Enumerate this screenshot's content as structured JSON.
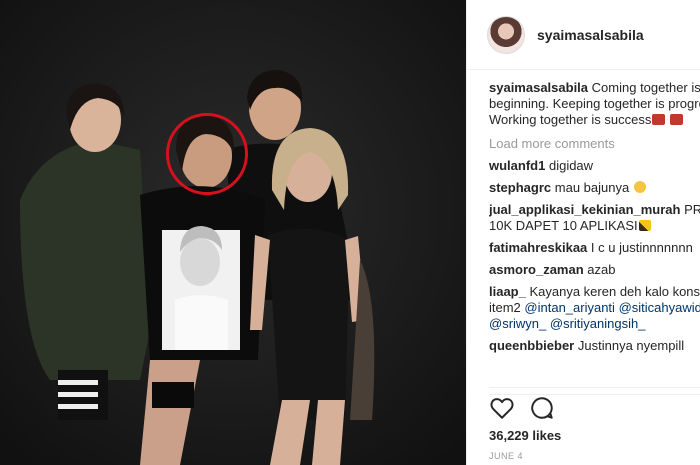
{
  "post": {
    "username": "syaimasalsabila"
  },
  "caption": {
    "user": "syaimasalsabila",
    "line1": "Coming together is a",
    "line2": "beginning. Keeping together is progress.",
    "line3": "Working together is success"
  },
  "load_more": "Load more comments",
  "comments": [
    {
      "user": "wulanfd1",
      "text": "digidaw"
    },
    {
      "user": "stephagrc",
      "text": "mau bajunya"
    },
    {
      "user": "jual_applikasi_kekinian_murah",
      "text": "PROMO",
      "line2": "10K DAPET 10 APLIKASI"
    },
    {
      "user": "fatimahreskikaa",
      "text": "I c u justinnnnnnn"
    },
    {
      "user": "asmoro_zaman",
      "text": "azab"
    },
    {
      "user": "liaap_",
      "text": "Kayanya keren deh kalo konser",
      "line2_plain": "item2 ",
      "line2_mentions": [
        "@intan_ariyanti",
        "@siticahyawidi"
      ],
      "line3_mentions": [
        "@sriwyn_",
        "@sritiyaningsih_"
      ]
    },
    {
      "user": "queenbbieber",
      "text": "Justinnya nyempill"
    }
  ],
  "likes": "36,229 likes",
  "date": "JUNE 4",
  "icons": {
    "like": "heart-icon",
    "comment": "comment-icon"
  },
  "colors": {
    "highlight": "#d8101e",
    "mention": "#003569",
    "muted": "#999999"
  }
}
